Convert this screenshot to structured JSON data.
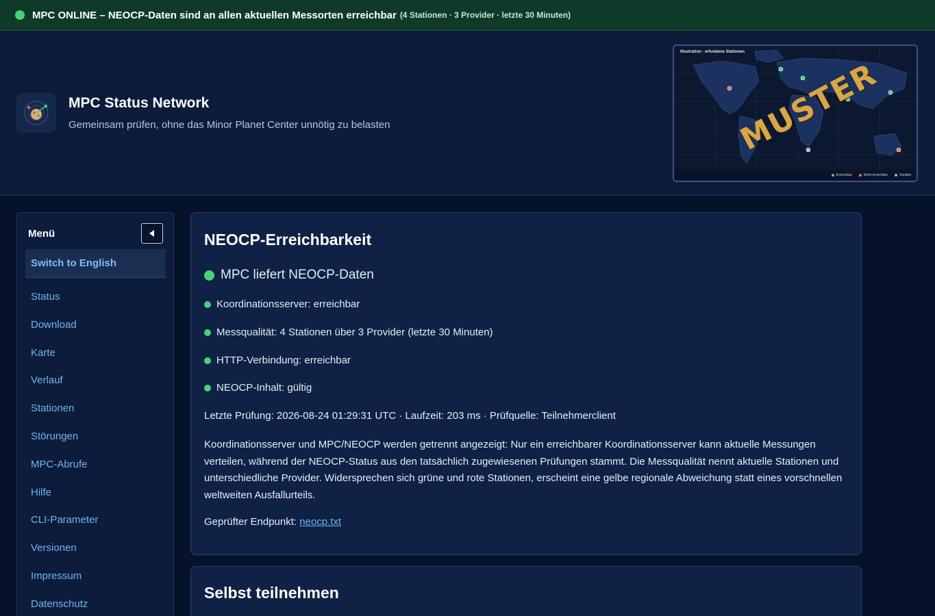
{
  "banner": {
    "status_color": "#4ad07a",
    "message": "MPC ONLINE – NEOCP-Daten sind an allen aktuellen Messorten erreichbar",
    "details": "(4 Stationen · 3 Provider · letzte 30 Minuten)"
  },
  "header": {
    "logo_icon": "radar-icon",
    "title": "MPC Status Network",
    "subtitle": "Gemeinsam prüfen, ohne das Minor Planet Center unnötig zu belasten",
    "map": {
      "label": "Illustration · erfundene Stationen",
      "stamp": "MUSTER",
      "legend": [
        {
          "label": "Erreichbar",
          "color": "#4ad07a"
        },
        {
          "label": "Nicht erreichbar",
          "color": "#ef6a6a"
        },
        {
          "label": "Veraltet",
          "color": "#aab4c2"
        }
      ]
    }
  },
  "sidebar": {
    "title": "Menü",
    "collapse_icon": "triangle-left-icon",
    "switch_language": "Switch to English",
    "items": [
      {
        "label": "Status"
      },
      {
        "label": "Download"
      },
      {
        "label": "Karte"
      },
      {
        "label": "Verlauf"
      },
      {
        "label": "Stationen"
      },
      {
        "label": "Störungen"
      },
      {
        "label": "MPC-Abrufe"
      },
      {
        "label": "Hilfe"
      },
      {
        "label": "CLI-Parameter"
      },
      {
        "label": "Versionen"
      },
      {
        "label": "Impressum"
      },
      {
        "label": "Datenschutz"
      }
    ]
  },
  "main": {
    "card1": {
      "title": "NEOCP-Erreichbarkeit",
      "status_headline": "MPC liefert NEOCP-Daten",
      "checks": [
        "Koordinationsserver: erreichbar",
        "Messqualität: 4 Stationen über 3 Provider (letzte 30 Minuten)",
        "HTTP-Verbindung: erreichbar",
        "NEOCP-Inhalt: gültig"
      ],
      "last_check": "Letzte Prüfung: 2026-08-24 01:29:31 UTC · Laufzeit: 203 ms · Prüfquelle: Teilnehmerclient",
      "explanation": "Koordinationsserver und MPC/NEOCP werden getrennt angezeigt: Nur ein erreichbarer Koordinationsserver kann aktuelle Messungen verteilen, während der NEOCP-Status aus den tatsächlich zugewiesenen Prüfungen stammt. Die Messqualität nennt aktuelle Stationen und unterschiedliche Provider. Widersprechen sich grüne und rote Stationen, erscheint eine gelbe regionale Abweichung statt eines vorschnellen weltweiten Ausfallurteils.",
      "endpoint_label": "Geprüfter Endpunkt:",
      "endpoint_link": "neocp.txt"
    },
    "card2": {
      "title": "Selbst teilnehmen"
    }
  }
}
